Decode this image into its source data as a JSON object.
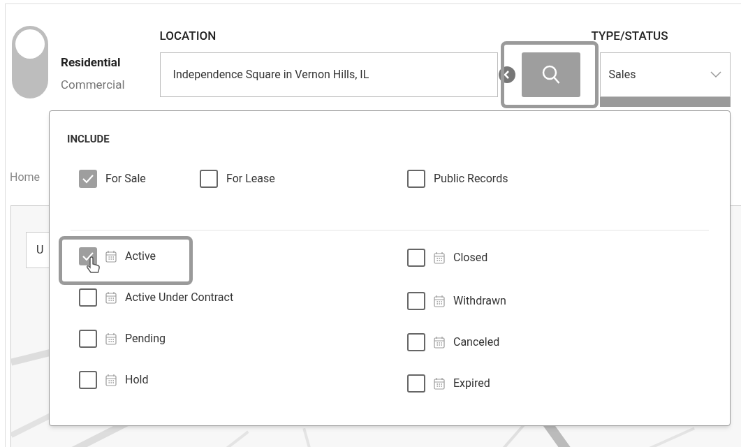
{
  "property_type": {
    "options": [
      {
        "label": "Residential",
        "selected": true
      },
      {
        "label": "Commercial",
        "selected": false
      }
    ]
  },
  "location": {
    "label": "LOCATION",
    "value": "Independence Square in Vernon Hills, IL"
  },
  "search_button": {
    "highlighted": true
  },
  "type_status": {
    "label": "TYPE/STATUS",
    "value": "Sales"
  },
  "background": {
    "breadcrumb": "Home",
    "field_value": "U"
  },
  "include_panel": {
    "title": "INCLUDE",
    "listing_types": [
      {
        "label": "For Sale",
        "checked": true
      },
      {
        "label": "For Lease",
        "checked": false
      },
      {
        "label": "Public Records",
        "checked": false
      }
    ],
    "left_statuses": [
      {
        "label": "Active",
        "checked": true,
        "highlighted": true
      },
      {
        "label": "Active Under Contract",
        "checked": false,
        "highlighted": false
      },
      {
        "label": "Pending",
        "checked": false,
        "highlighted": false
      },
      {
        "label": "Hold",
        "checked": false,
        "highlighted": false
      }
    ],
    "right_statuses": [
      {
        "label": "Closed",
        "checked": false,
        "highlighted": false
      },
      {
        "label": "Withdrawn",
        "checked": false,
        "highlighted": false
      },
      {
        "label": "Canceled",
        "checked": false,
        "highlighted": false
      },
      {
        "label": "Expired",
        "checked": false,
        "highlighted": false
      }
    ]
  }
}
